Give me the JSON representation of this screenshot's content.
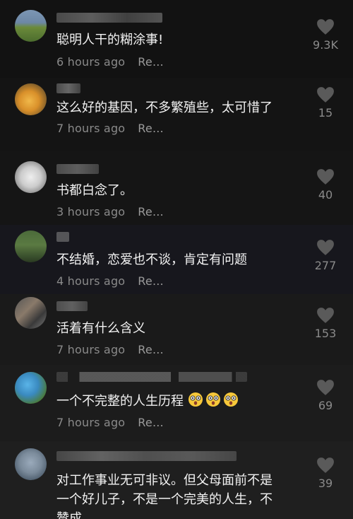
{
  "comments": [
    {
      "text": "聪明人干的糊涂事!",
      "time": "6 hours ago",
      "reply": "Re...",
      "likes": "9.3K"
    },
    {
      "text": "这么好的基因，不多繁殖些，太可惜了",
      "time": "7 hours ago",
      "reply": "Re...",
      "likes": "15"
    },
    {
      "text": "书都白念了。",
      "time": "3 hours ago",
      "reply": "Re...",
      "likes": "40"
    },
    {
      "text": "不结婚，恋爱也不谈，肯定有问题",
      "time": "4 hours ago",
      "reply": "Re...",
      "likes": "277"
    },
    {
      "text": "活着有什么含义",
      "time": "7 hours ago",
      "reply": "Re...",
      "likes": "153"
    },
    {
      "text": "一个不完整的人生历程",
      "time": "7 hours ago",
      "reply": "Re...",
      "likes": "69",
      "emoji": "astonished-emoji"
    },
    {
      "text": "对工作事业无可非议。但父母面前不是\n一个好儿子，不是一个完美的人生，不\n赞成",
      "time": "",
      "reply": "",
      "likes": "39"
    }
  ],
  "colors": {
    "background": "#111111",
    "text": "#f2f2f2",
    "secondary": "#8a8a8a",
    "heart": "#5a5a5a"
  },
  "icons": {
    "like": "heart-icon"
  }
}
